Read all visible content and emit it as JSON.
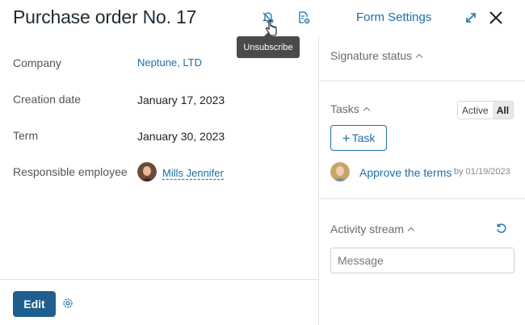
{
  "header": {
    "title": "Purchase order No. 17",
    "form_settings_label": "Form Settings",
    "tooltip": "Unsubscribe",
    "icons": [
      "bell-off-icon",
      "document-settings-icon",
      "expand-icon",
      "close-icon"
    ]
  },
  "fields": [
    {
      "label": "Company",
      "value": "Neptune, LTD"
    },
    {
      "label": "Creation date",
      "value": "January 17, 2023"
    },
    {
      "label": "Term",
      "value": "January 30, 2023"
    },
    {
      "label": "Responsible employee",
      "value": "Mills Jennifer"
    }
  ],
  "footer": {
    "edit_label": "Edit"
  },
  "right_panel": {
    "signature_status_label": "Signature status",
    "tasks": {
      "title": "Tasks",
      "filter_active": "Active",
      "filter_all": "All",
      "add_task_label": "Task",
      "items": [
        {
          "title": "Approve the terms",
          "due": "by 01/19/2023"
        }
      ]
    },
    "activity_stream": {
      "title": "Activity stream",
      "message_placeholder": "Message"
    }
  },
  "colors": {
    "link": "#1d6fa8",
    "primary_button": "#1f5f8f",
    "tooltip_bg": "#4a4a4a",
    "divider": "#e3e3e3"
  }
}
